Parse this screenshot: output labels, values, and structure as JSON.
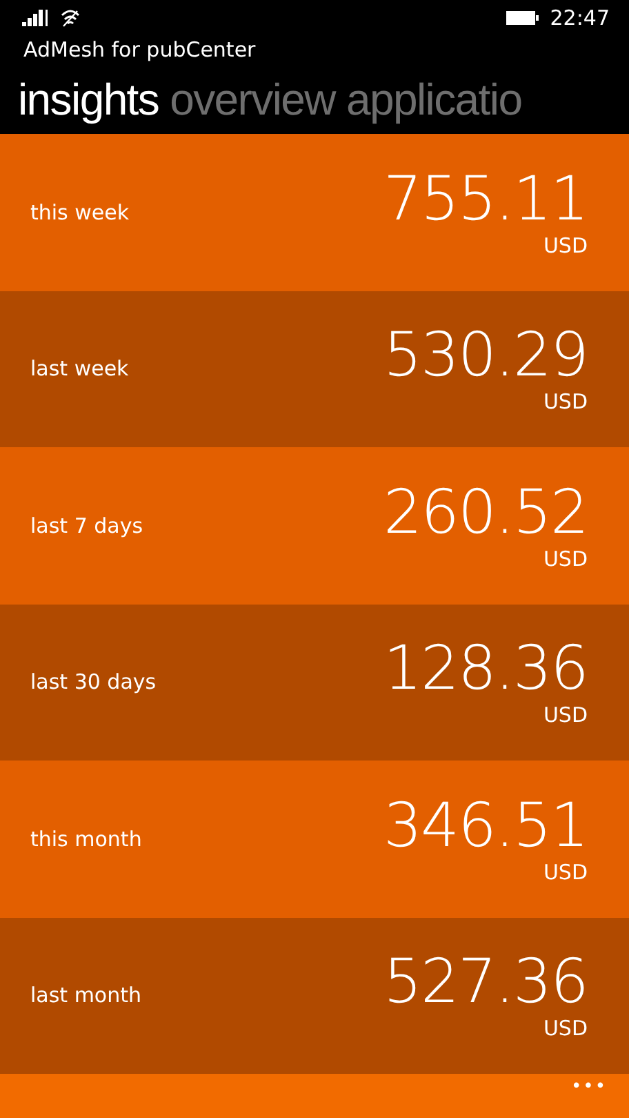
{
  "status_bar": {
    "time": "22:47"
  },
  "app_title": "AdMesh for pubCenter",
  "tabs": [
    {
      "label": "insights",
      "selected": true
    },
    {
      "label": "overview",
      "selected": false
    },
    {
      "label": "applicatio",
      "selected": false
    }
  ],
  "rows": [
    {
      "label": "this week",
      "value": "755.11",
      "currency": "USD",
      "color": "#e35f00"
    },
    {
      "label": "last week",
      "value": "530.29",
      "currency": "USD",
      "color": "#b14a00"
    },
    {
      "label": "last 7 days",
      "value": "260.52",
      "currency": "USD",
      "color": "#e35f00"
    },
    {
      "label": "last 30 days",
      "value": "128.36",
      "currency": "USD",
      "color": "#b14a00"
    },
    {
      "label": "this month",
      "value": "346.51",
      "currency": "USD",
      "color": "#e35f00"
    },
    {
      "label": "last month",
      "value": "527.36",
      "currency": "USD",
      "color": "#b14a00"
    }
  ],
  "app_bar": {
    "more": "•••"
  }
}
